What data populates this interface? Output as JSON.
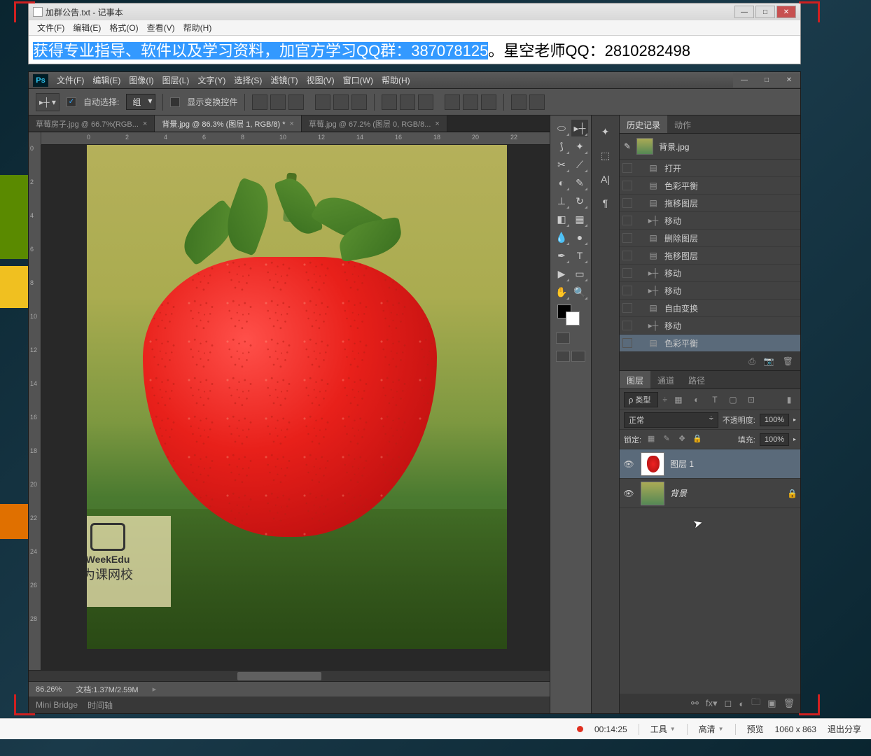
{
  "notepad": {
    "title": "加群公告.txt - 记事本",
    "menu": [
      "文件(F)",
      "编辑(E)",
      "格式(O)",
      "查看(V)",
      "帮助(H)"
    ],
    "highlightText": "获得专业指导、软件以及学习资料，加官方学习QQ群：387078125",
    "trailingText": "。星空老师QQ：2810282498"
  },
  "ps": {
    "menu": [
      "文件(F)",
      "编辑(E)",
      "图像(I)",
      "图层(L)",
      "文字(Y)",
      "选择(S)",
      "滤镜(T)",
      "视图(V)",
      "窗口(W)",
      "帮助(H)"
    ],
    "options": {
      "autoSelectLabel": "自动选择:",
      "autoSelectValue": "组",
      "showTransformLabel": "显示变换控件"
    },
    "tabs": [
      {
        "label": "草莓房子.jpg @ 66.7%(RGB...",
        "active": false
      },
      {
        "label": "背景.jpg @ 86.3% (图层 1, RGB/8) *",
        "active": true
      },
      {
        "label": "草莓.jpg @ 67.2% (图层 0, RGB/8...",
        "active": false
      }
    ],
    "rulerH": [
      "0",
      "2",
      "4",
      "6",
      "8",
      "10",
      "12",
      "14",
      "16",
      "18",
      "20",
      "22"
    ],
    "rulerV": [
      "0",
      "2",
      "4",
      "6",
      "8",
      "10",
      "12",
      "14",
      "16",
      "18",
      "20",
      "22",
      "24",
      "26",
      "28"
    ],
    "status": {
      "zoom": "86.26%",
      "doc": "文档:1.37M/2.59M"
    },
    "bridge": {
      "mini": "Mini Bridge",
      "timeline": "时间轴"
    }
  },
  "extras": [
    "✦",
    "⬚",
    "A|",
    "¶"
  ],
  "history": {
    "tabs": [
      "历史记录",
      "动作"
    ],
    "docName": "背景.jpg",
    "items": [
      {
        "icon": "▤",
        "label": "打开"
      },
      {
        "icon": "▤",
        "label": "色彩平衡"
      },
      {
        "icon": "▤",
        "label": "拖移图层"
      },
      {
        "icon": "▸┼",
        "label": "移动"
      },
      {
        "icon": "▤",
        "label": "删除图层"
      },
      {
        "icon": "▤",
        "label": "拖移图层"
      },
      {
        "icon": "▸┼",
        "label": "移动"
      },
      {
        "icon": "▸┼",
        "label": "移动"
      },
      {
        "icon": "▤",
        "label": "自由变换"
      },
      {
        "icon": "▸┼",
        "label": "移动"
      },
      {
        "icon": "▤",
        "label": "色彩平衡",
        "active": true
      }
    ]
  },
  "layers": {
    "tabs": [
      "图层",
      "通道",
      "路径"
    ],
    "kind": "ρ 类型",
    "blend": "正常",
    "opacityLabel": "不透明度:",
    "opacityValue": "100%",
    "lockLabel": "锁定:",
    "fillLabel": "填充:",
    "fillValue": "100%",
    "items": [
      {
        "name": "图层 1",
        "thumb": "strawb",
        "active": true,
        "locked": false
      },
      {
        "name": "背景",
        "thumb": "bg",
        "active": false,
        "locked": true,
        "italic": true
      }
    ]
  },
  "videoBar": {
    "time": "00:14:25",
    "tool": "工具",
    "quality": "高清",
    "preview": "预览",
    "size": "1060 x 863",
    "exit": "退出分享"
  },
  "watermark": {
    "line1": "WeekEdu",
    "line2": "为课网校"
  }
}
